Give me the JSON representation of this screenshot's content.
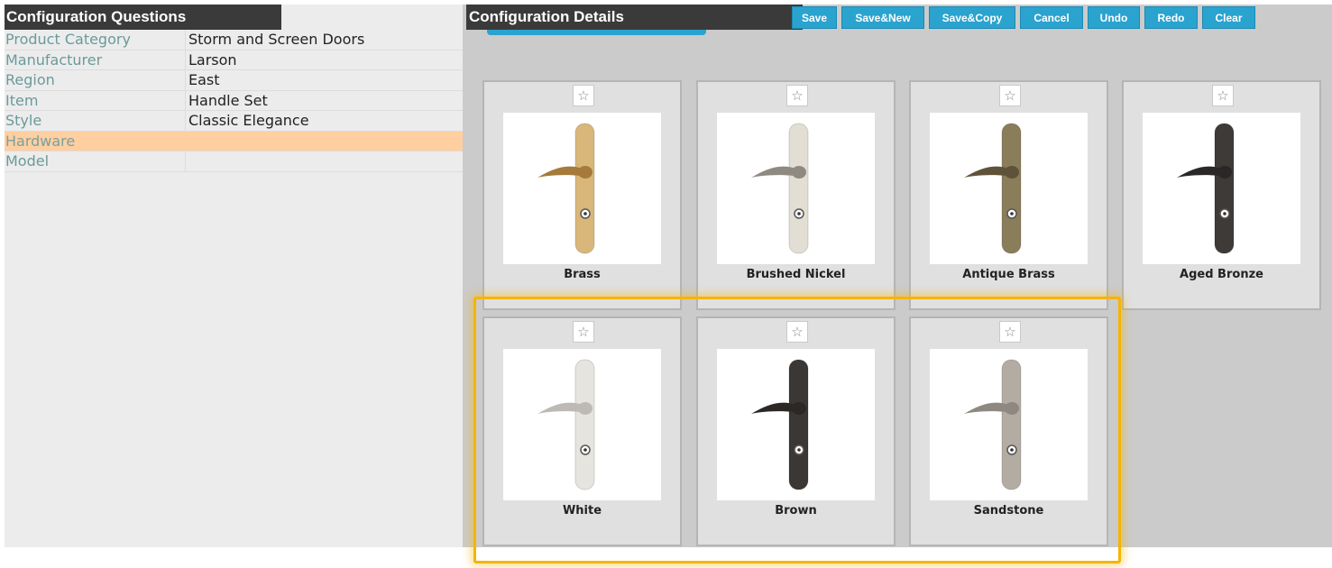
{
  "left": {
    "title": "Configuration Questions",
    "rows": [
      {
        "label": "Product Category",
        "value": "Storm and Screen Doors"
      },
      {
        "label": "Manufacturer",
        "value": "Larson"
      },
      {
        "label": "Region",
        "value": "East"
      },
      {
        "label": "Item",
        "value": "Handle Set"
      },
      {
        "label": "Style",
        "value": "Classic Elegance"
      },
      {
        "label": "Hardware",
        "value": ""
      },
      {
        "label": "Model",
        "value": ""
      }
    ]
  },
  "right": {
    "title": "Configuration Details",
    "toolbar": {
      "save": "Save",
      "save_new": "Save&New",
      "save_copy": "Save&Copy",
      "cancel": "Cancel",
      "undo": "Undo",
      "redo": "Redo",
      "clear": "Clear"
    },
    "options": [
      {
        "label": "Brass",
        "finish": "#d9b77a",
        "lever": "#a57a3a",
        "icon": "star-outline-icon"
      },
      {
        "label": "Brushed Nickel",
        "finish": "#e2ded4",
        "lever": "#8e8a82",
        "icon": "star-outline-icon"
      },
      {
        "label": "Antique Brass",
        "finish": "#8a7d5a",
        "lever": "#5e5238",
        "icon": "star-outline-icon"
      },
      {
        "label": "Aged Bronze",
        "finish": "#3d3a37",
        "lever": "#2a2826",
        "icon": "star-outline-icon"
      },
      {
        "label": "White",
        "finish": "#e6e4df",
        "lever": "#bdbab3",
        "icon": "star-outline-icon"
      },
      {
        "label": "Brown",
        "finish": "#3b3734",
        "lever": "#2b2826",
        "icon": "star-outline-icon"
      },
      {
        "label": "Sandstone",
        "finish": "#b3aca2",
        "lever": "#8f8880",
        "icon": "star-outline-icon"
      }
    ]
  },
  "colors": {
    "accent": "#2aa3cf",
    "active_row": "#ffcfa0",
    "highlight": "#f6b400"
  }
}
